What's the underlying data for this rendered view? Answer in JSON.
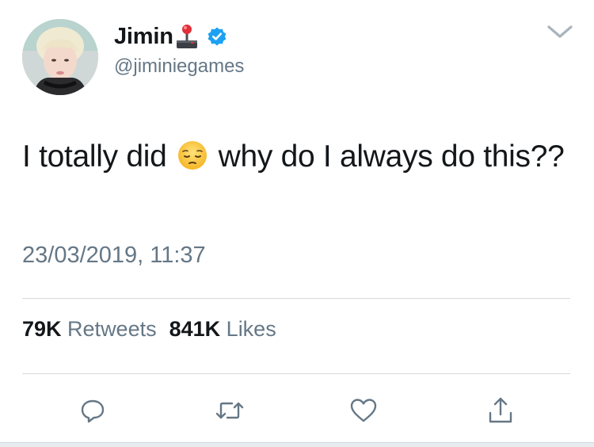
{
  "tweet": {
    "author": {
      "display_name": "Jimin",
      "handle": "@jiminiegames",
      "verified": true,
      "name_emoji_icon": "joystick-icon"
    },
    "text_before_emoji": "I totally did ",
    "emoji_name": "pensive-face-emoji",
    "text_after_emoji": " why do I always do this??",
    "timestamp": "23/03/2019, 11:37",
    "stats": {
      "retweets_count": "79K",
      "retweets_label": "Retweets",
      "likes_count": "841K",
      "likes_label": "Likes"
    },
    "actions": [
      "reply-icon",
      "retweet-icon",
      "like-icon",
      "share-icon"
    ]
  },
  "colors": {
    "text_primary": "#14171a",
    "text_secondary": "#657786",
    "verified_blue": "#1da1f2",
    "divider": "#d6dade",
    "action_icon": "#657786"
  }
}
